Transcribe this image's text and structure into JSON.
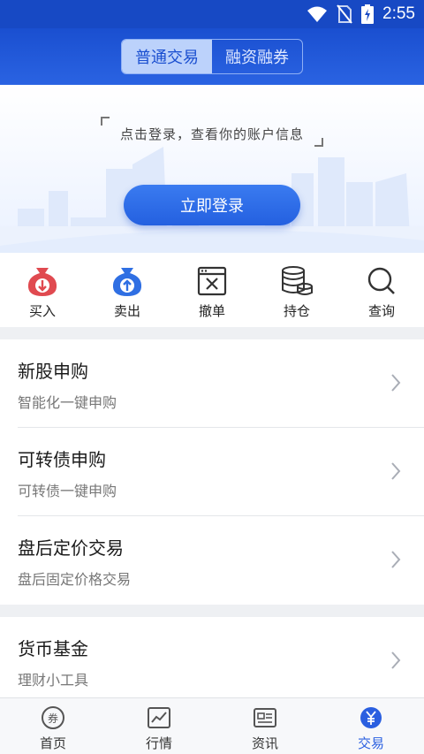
{
  "status_bar": {
    "time": "2:55"
  },
  "header": {
    "tabs": [
      {
        "label": "普通交易",
        "active": true
      },
      {
        "label": "融资融券",
        "active": false
      }
    ]
  },
  "login": {
    "hint": "点击登录，查看你的账户信息",
    "button_label": "立即登录"
  },
  "actions": [
    {
      "label": "买入",
      "icon": "buy-bag-icon"
    },
    {
      "label": "卖出",
      "icon": "sell-bag-icon"
    },
    {
      "label": "撤单",
      "icon": "cancel-order-icon"
    },
    {
      "label": "持仓",
      "icon": "coins-stack-icon"
    },
    {
      "label": "查询",
      "icon": "search-icon"
    }
  ],
  "list": [
    {
      "title": "新股申购",
      "subtitle": "智能化一键申购"
    },
    {
      "title": "可转债申购",
      "subtitle": "可转债一键申购"
    },
    {
      "title": "盘后定价交易",
      "subtitle": "盘后固定价格交易"
    },
    {
      "title": "货币基金",
      "subtitle": "理财小工具"
    }
  ],
  "bottom_nav": [
    {
      "label": "首页",
      "icon": "coupon-icon",
      "active": false
    },
    {
      "label": "行情",
      "icon": "chart-icon",
      "active": false
    },
    {
      "label": "资讯",
      "icon": "news-icon",
      "active": false
    },
    {
      "label": "交易",
      "icon": "yuan-icon",
      "active": true
    }
  ],
  "colors": {
    "brand_blue": "#1a4fd0",
    "button_blue": "#2a63e2",
    "buy_red": "#d9363e",
    "sell_blue": "#2f6fe3"
  }
}
